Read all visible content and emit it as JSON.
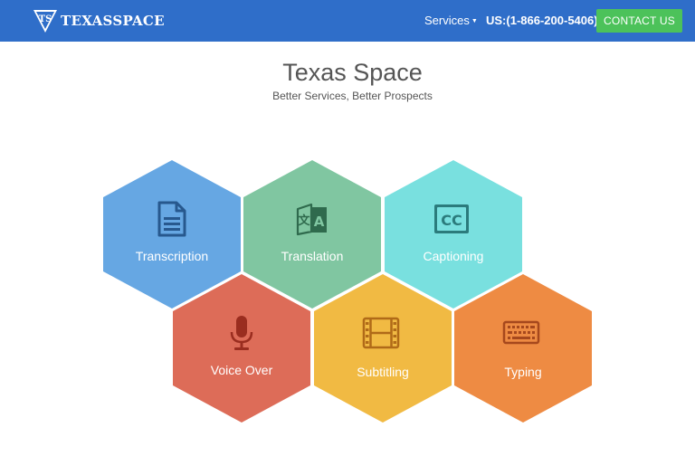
{
  "header": {
    "brand_name": "TEXASSPACE",
    "logo_icon": "texasspace-logo-icon",
    "services_label": "Services",
    "phone": "US:(1-866-200-5406)",
    "contact_label": "CONTACT US",
    "background_color": "#2f6ec9",
    "contact_color": "#4cc25a"
  },
  "hero": {
    "title": "Texas Space",
    "subtitle": "Better Services, Better Prospects"
  },
  "services": [
    {
      "label": "Transcription",
      "icon": "document-icon",
      "color": "#66a7e3",
      "icon_color": "#27588e"
    },
    {
      "label": "Translation",
      "icon": "translation-icon",
      "color": "#80c6a1",
      "icon_color": "#2f6a4d"
    },
    {
      "label": "Captioning",
      "icon": "closed-caption-icon",
      "color": "#79e0df",
      "icon_color": "#2b7b7c"
    },
    {
      "label": "Voice Over",
      "icon": "microphone-icon",
      "color": "#dd6c58",
      "icon_color": "#9a2d1f"
    },
    {
      "label": "Subtitling",
      "icon": "film-icon",
      "color": "#f1ba43",
      "icon_color": "#b06a18"
    },
    {
      "label": "Typing",
      "icon": "keyboard-icon",
      "color": "#ee8b43",
      "icon_color": "#a6481d"
    }
  ]
}
